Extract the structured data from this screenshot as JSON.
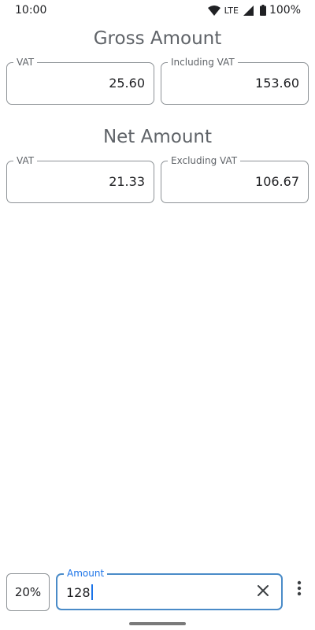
{
  "status_bar": {
    "time": "10:00",
    "network": "LTE",
    "battery": "100%",
    "icons": [
      "wifi-icon",
      "cell-signal-icon",
      "battery-icon"
    ]
  },
  "gross": {
    "title": "Gross Amount",
    "vat_label": "VAT",
    "vat_value": "25.60",
    "total_label": "Including VAT",
    "total_value": "153.60"
  },
  "net": {
    "title": "Net Amount",
    "vat_label": "VAT",
    "vat_value": "21.33",
    "total_label": "Excluding VAT",
    "total_value": "106.67"
  },
  "input_bar": {
    "rate": "20%",
    "amount_label": "Amount",
    "amount_value": "128",
    "icons": [
      "clear-icon",
      "more-vert-icon"
    ]
  },
  "colors": {
    "accent": "#1a73e8",
    "focused_border": "#4a8bc8",
    "outline": "#8d9296",
    "title_gray": "#5f6368"
  }
}
